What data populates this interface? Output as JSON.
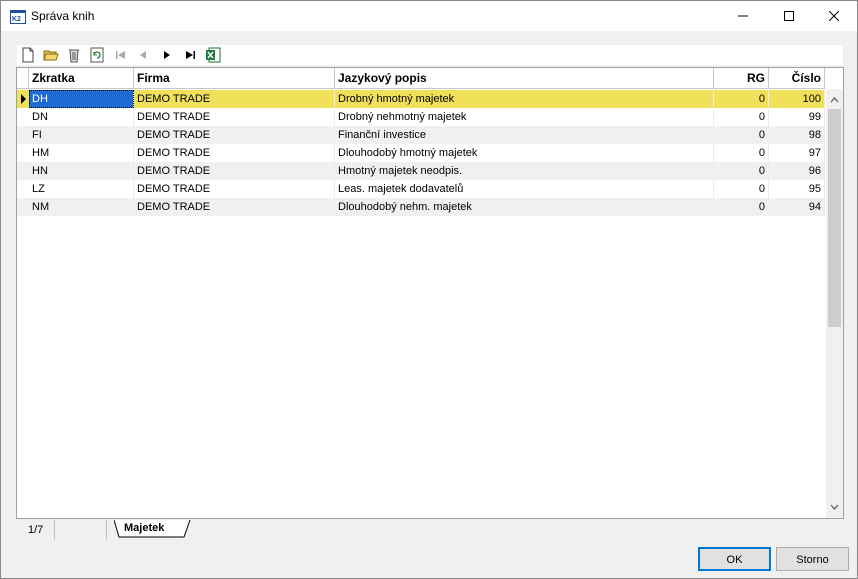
{
  "window": {
    "title": "Správa knih"
  },
  "toolbar": {
    "buttons": [
      "new-icon",
      "open-folder-icon",
      "delete-icon",
      "refresh-icon",
      "first-record-icon",
      "previous-record-icon",
      "next-record-icon",
      "last-record-icon",
      "excel-export-icon"
    ]
  },
  "grid": {
    "columns": [
      "Zkratka",
      "Firma",
      "Jazykový popis",
      "RG",
      "Číslo"
    ],
    "rows": [
      {
        "zkratka": "DH",
        "firma": "DEMO TRADE",
        "popis": "Drobný hmotný majetek",
        "rg": "0",
        "cislo": "100"
      },
      {
        "zkratka": "DN",
        "firma": "DEMO TRADE",
        "popis": "Drobný nehmotný majetek",
        "rg": "0",
        "cislo": "99"
      },
      {
        "zkratka": "FI",
        "firma": "DEMO TRADE",
        "popis": "Finanční investice",
        "rg": "0",
        "cislo": "98"
      },
      {
        "zkratka": "HM",
        "firma": "DEMO TRADE",
        "popis": "Dlouhodobý hmotný majetek",
        "rg": "0",
        "cislo": "97"
      },
      {
        "zkratka": "HN",
        "firma": "DEMO TRADE",
        "popis": "Hmotný majetek neodpis.",
        "rg": "0",
        "cislo": "96"
      },
      {
        "zkratka": "LZ",
        "firma": "DEMO TRADE",
        "popis": "Leas. majetek dodavatelů",
        "rg": "0",
        "cislo": "95"
      },
      {
        "zkratka": "NM",
        "firma": "DEMO TRADE",
        "popis": "Dlouhodobý nehm. majetek",
        "rg": "0",
        "cislo": "94"
      }
    ]
  },
  "status": {
    "record_counter": "1/7",
    "tab": "Majetek"
  },
  "buttons": {
    "ok": "OK",
    "cancel": "Storno"
  },
  "colors": {
    "selected_row": "#f1e05a",
    "alt_row": "#f0f0f0",
    "focus_border": "#0078d7"
  }
}
